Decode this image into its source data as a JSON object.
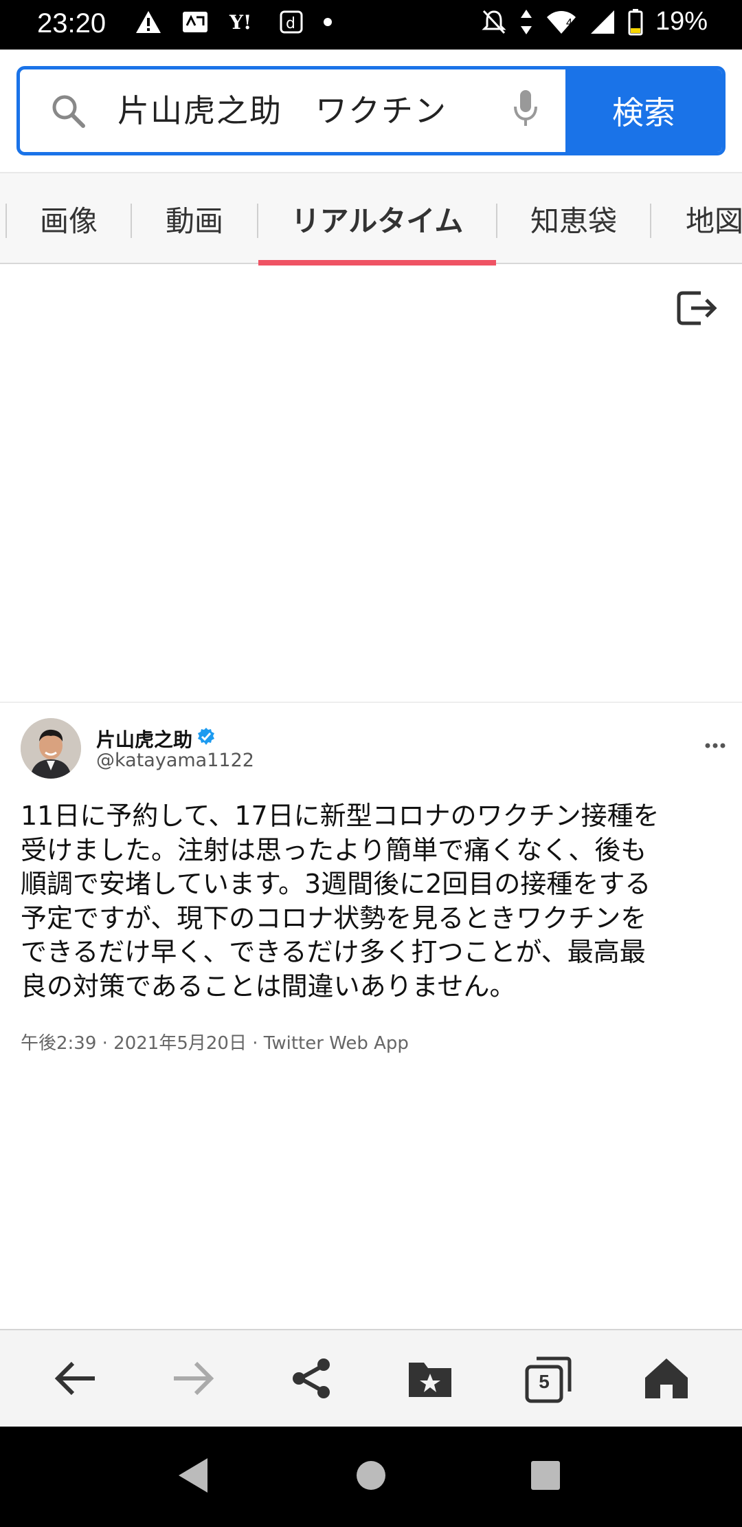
{
  "status_bar": {
    "time": "23:20",
    "battery_percent": "19%",
    "signal_badge": "4",
    "left_icons": [
      "warning-icon",
      "notification-icon",
      "yahoo-icon",
      "docomo-icon",
      "dot-icon"
    ],
    "right_icons": [
      "mute-icon",
      "data-arrows-icon",
      "wifi-icon",
      "signal-icon",
      "battery-icon"
    ]
  },
  "search": {
    "query": "片山虎之助　ワクチン",
    "button_label": "検索",
    "accent_color": "#1a73e8"
  },
  "tabs": [
    {
      "label": "画像"
    },
    {
      "label": "動画"
    },
    {
      "label": "リアルタイム",
      "active": true
    },
    {
      "label": "知恵袋"
    },
    {
      "label": "地図"
    }
  ],
  "tab_active_color": "#ef5364",
  "tweet": {
    "display_name": "片山虎之助",
    "handle": "@katayama1122",
    "verified": true,
    "text_lines": [
      "11日に予約して、17日に新型コロナのワクチン接種を",
      "受けました。注射は思ったより簡単で痛くなく、後も",
      "順調で安堵しています。3週間後に2回目の接種をする",
      "予定ですが、現下のコロナ状勢を見るときワクチンを",
      "できるだけ早く、できるだけ多く打つことが、最高最",
      "良の対策であることは間違いありません。"
    ],
    "meta": "午後2:39 · 2021年5月20日 · Twitter Web App"
  },
  "toolbar": {
    "tab_count": "5",
    "buttons": [
      "back-icon",
      "forward-icon",
      "share-icon",
      "bookmark-folder-icon",
      "tabs-icon",
      "home-icon"
    ]
  }
}
